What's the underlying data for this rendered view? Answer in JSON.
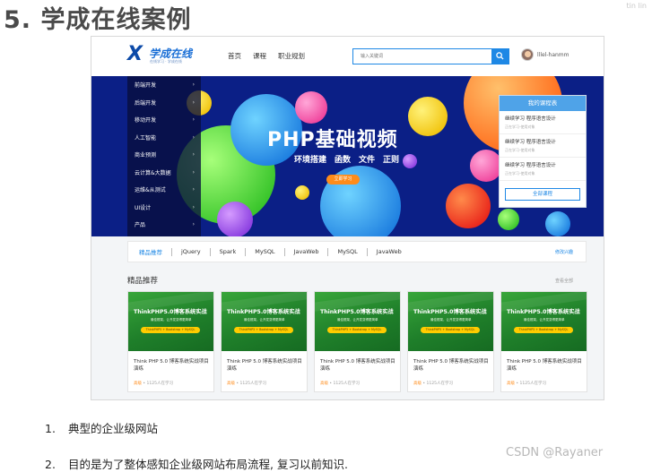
{
  "slide": {
    "title": "5. 学成在线案例",
    "corner_mark": "tin lin",
    "watermark": "CSDN @Rayaner",
    "notes": [
      {
        "num": "1.",
        "text": "典型的企业级网站"
      },
      {
        "num": "2.",
        "text": "目的是为了整体感知企业级网站布局流程, 复习以前知识."
      }
    ]
  },
  "header": {
    "logo_mark": "X",
    "logo_name": "学成在线",
    "logo_slogan": "在线学习 · 学成在线",
    "nav": [
      "首页",
      "课程",
      "职业规划"
    ],
    "search_placeholder": "输入关键词",
    "username": "lllel-hanmm"
  },
  "sidebar": {
    "items": [
      "前端开发",
      "后端开发",
      "移动开发",
      "人工智能",
      "商业预测",
      "云计算&大数据",
      "运维&从测试",
      "UI设计",
      "产品"
    ],
    "arrow": "›"
  },
  "banner": {
    "title": "PHP基础视频",
    "subtitle": [
      "环境搭建",
      "函数",
      "文件",
      "正则"
    ],
    "button": "立即学习"
  },
  "my_courses": {
    "title": "我的课程表",
    "items": [
      {
        "title": "继续学习 程序语言设计",
        "sub": "正在学习-使用对象"
      },
      {
        "title": "继续学习 程序语言设计",
        "sub": "正在学习-使用对象"
      },
      {
        "title": "继续学习 程序语言设计",
        "sub": "正在学习-使用对象"
      }
    ],
    "button": "全部课程"
  },
  "tabs": {
    "items": [
      "精品推荐",
      "jQuery",
      "Spark",
      "MySQL",
      "JavaWeb",
      "MySQL",
      "JavaWeb"
    ],
    "edit": "修改兴趣"
  },
  "section": {
    "title": "精品推荐",
    "more": "查看全部"
  },
  "cards": [
    {
      "thumb_title": "ThinkPHP5.0博客系统实战",
      "thumb_sub": "最佳框架，让开发变得更简单",
      "thumb_tag": "ThinkPHP5 + Bootstrap + MySQL",
      "name": "Think PHP 5.0 博客系统实战项目演练",
      "level": "高级",
      "learners": " • 1125人在学习"
    },
    {
      "thumb_title": "ThinkPHP5.0博客系统实战",
      "thumb_sub": "最佳框架，让开发变得更简单",
      "thumb_tag": "ThinkPHP5 + Bootstrap + MySQL",
      "name": "Think PHP 5.0 博客系统实战项目演练",
      "level": "高级",
      "learners": " • 1125人在学习"
    },
    {
      "thumb_title": "ThinkPHP5.0博客系统实战",
      "thumb_sub": "最佳框架，让开发变得更简单",
      "thumb_tag": "ThinkPHP5 + Bootstrap + MySQL",
      "name": "Think PHP 5.0 博客系统实战项目演练",
      "level": "高级",
      "learners": " • 1125人在学习"
    },
    {
      "thumb_title": "ThinkPHP5.0博客系统实战",
      "thumb_sub": "最佳框架，让开发变得更简单",
      "thumb_tag": "ThinkPHP5 + Bootstrap + MySQL",
      "name": "Think PHP 5.0 博客系统实战项目演练",
      "level": "高级",
      "learners": " • 1125人在学习"
    },
    {
      "thumb_title": "ThinkPHP5.0博客系统实战",
      "thumb_sub": "最佳框架，让开发变得更简单",
      "thumb_tag": "ThinkPHP5 + Bootstrap + MySQL",
      "name": "Think PHP 5.0 博客系统实战项目演练",
      "level": "高级",
      "learners": " • 1125人在学习"
    }
  ],
  "colors": {
    "brand_blue": "#1e88e5",
    "banner_bg": "#0a1e80",
    "accent_orange": "#ff8c1a",
    "card_green": "#2a8f32"
  }
}
